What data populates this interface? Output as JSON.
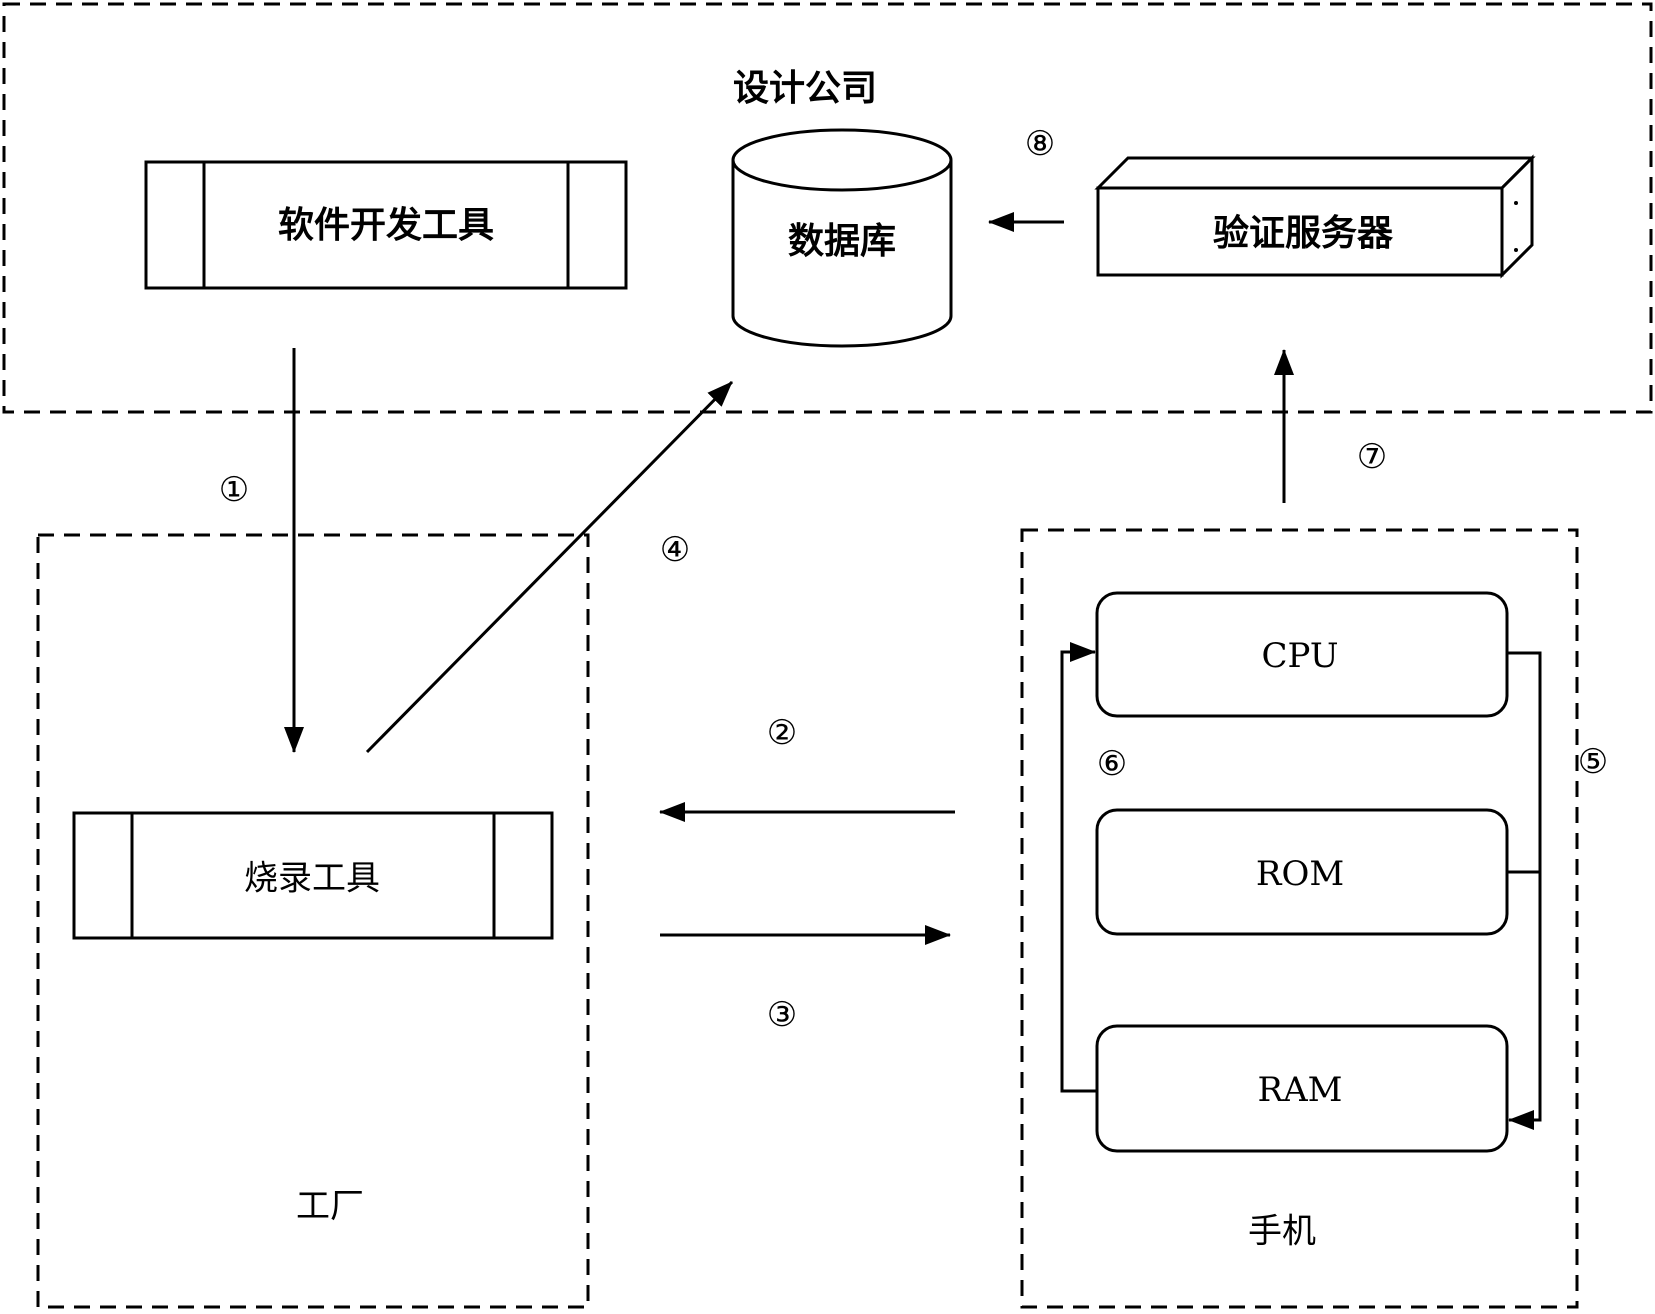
{
  "groups": {
    "design_company": "设计公司",
    "factory": "工厂",
    "phone": "手机"
  },
  "nodes": {
    "software_dev_tool": "软件开发工具",
    "database": "数据库",
    "verification_server": "验证服务器",
    "burning_tool": "烧录工具",
    "cpu": "CPU",
    "rom": "ROM",
    "ram": "RAM"
  },
  "steps": [
    "①",
    "②",
    "③",
    "④",
    "⑤",
    "⑥",
    "⑦",
    "⑧"
  ]
}
